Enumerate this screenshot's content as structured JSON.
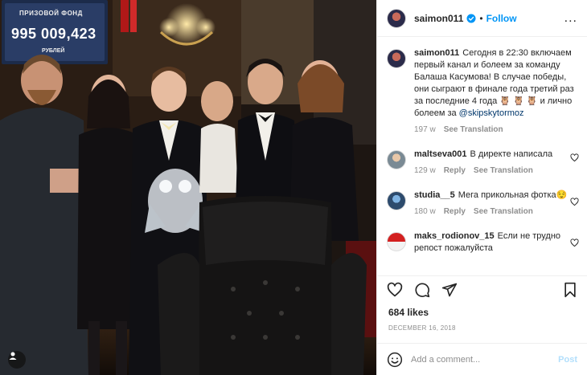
{
  "photo": {
    "board": {
      "label": "ПРИЗОВОЙ ФОНД",
      "amount": "995 009,423",
      "currency": "РУБЛЕЙ"
    }
  },
  "header": {
    "username": "saimon011",
    "follow_label": "Follow",
    "separator": "•",
    "more_label": "..."
  },
  "caption": {
    "username": "saimon011",
    "text": "Сегодня в 22:30 включаем первый канал и болеем за команду Балаша Касумова! В случае победы, они сыграют в финале года третий раз за последние 4 года 🦉 🦉 🦉 и лично болеем за ",
    "mention": "@skipskytormoz",
    "time": "197 w",
    "see_translation": "See Translation"
  },
  "comments": [
    {
      "username": "maltseva001",
      "text": "В директе написала",
      "time": "129 w",
      "reply": "Reply",
      "see_translation": "See Translation"
    },
    {
      "username": "studia__5",
      "text": "Мега прикольная фотка😌",
      "time": "180 w",
      "reply": "Reply",
      "see_translation": "See Translation"
    },
    {
      "username": "maks_rodionov_15",
      "text": "Если не трудно репост пожалуйста"
    }
  ],
  "engagement": {
    "likes": "684 likes",
    "date": "December 16, 2018"
  },
  "add_comment": {
    "placeholder": "Add a comment...",
    "post_label": "Post"
  },
  "icons": {
    "heart": "heart-icon",
    "comment": "comment-icon",
    "share": "share-icon",
    "save": "bookmark-icon",
    "emoji": "emoji-icon",
    "verified": "verified-badge-icon",
    "user_tag": "user-tag-icon"
  },
  "colors": {
    "accent": "#0095f6",
    "muted": "#8e8e8e",
    "text": "#262626",
    "post_disabled": "#b2dffc"
  }
}
